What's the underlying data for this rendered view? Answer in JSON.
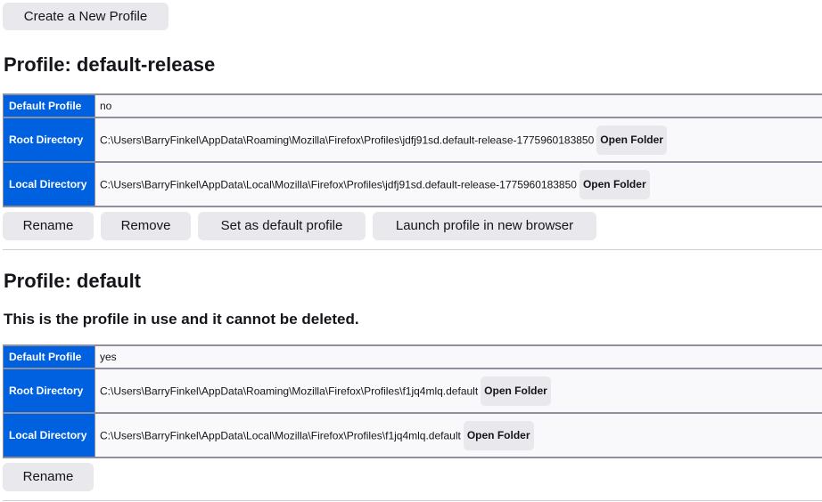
{
  "create_button": "Create a New Profile",
  "profiles": [
    {
      "heading": "Profile: default-release",
      "note": "",
      "rows": [
        {
          "label": "Default Profile",
          "value": "no"
        },
        {
          "label": "Root Directory",
          "value": "C:\\Users\\BarryFinkel\\AppData\\Roaming\\Mozilla\\Firefox\\Profiles\\jdfj91sd.default-release-1775960183850",
          "action": "Open Folder"
        },
        {
          "label": "Local Directory",
          "value": "C:\\Users\\BarryFinkel\\AppData\\Local\\Mozilla\\Firefox\\Profiles\\jdfj91sd.default-release-1775960183850",
          "action": "Open Folder"
        }
      ],
      "actions": {
        "rename": "Rename",
        "remove": "Remove",
        "set_default": "Set as default profile",
        "launch": "Launch profile in new browser"
      }
    },
    {
      "heading": "Profile: default",
      "note": "This is the profile in use and it cannot be deleted.",
      "rows": [
        {
          "label": "Default Profile",
          "value": "yes"
        },
        {
          "label": "Root Directory",
          "value": "C:\\Users\\BarryFinkel\\AppData\\Roaming\\Mozilla\\Firefox\\Profiles\\f1jq4mlq.default",
          "action": "Open Folder"
        },
        {
          "label": "Local Directory",
          "value": "C:\\Users\\BarryFinkel\\AppData\\Local\\Mozilla\\Firefox\\Profiles\\f1jq4mlq.default",
          "action": "Open Folder"
        }
      ],
      "actions": {
        "rename": "Rename"
      }
    }
  ]
}
